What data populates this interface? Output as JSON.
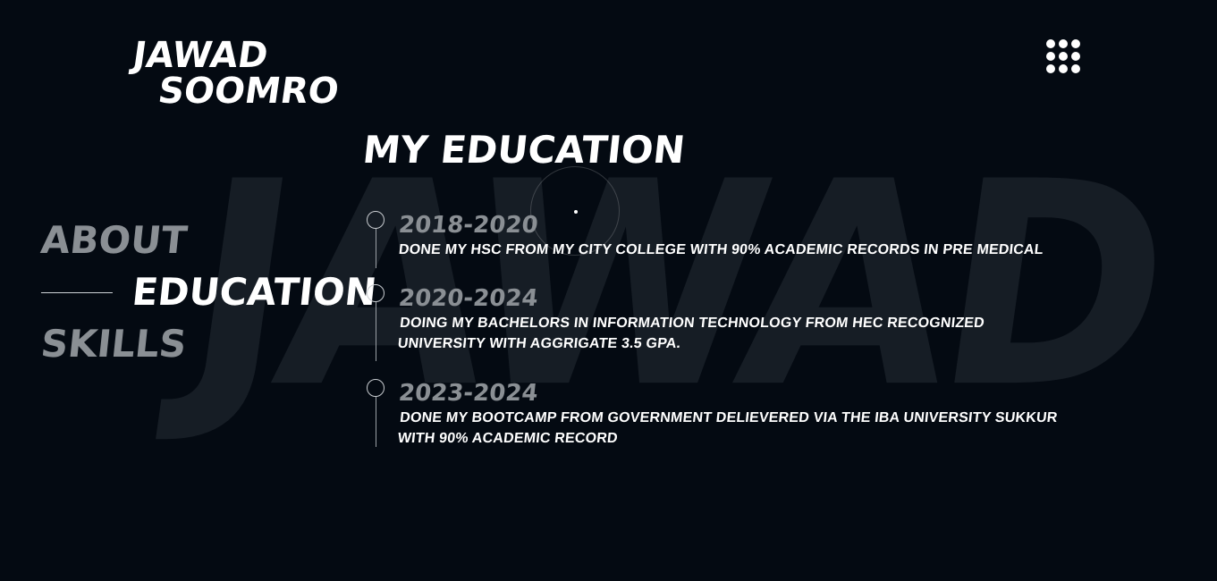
{
  "brand": {
    "line1": "JAWAD",
    "line2": "SOOMRO"
  },
  "watermark": "JAWAD",
  "menu": {
    "icon": "grid-dots-icon"
  },
  "nav": {
    "items": [
      {
        "label": "ABOUT",
        "active": false
      },
      {
        "label": "EDUCATION",
        "active": true
      },
      {
        "label": "SKILLS",
        "active": false
      }
    ]
  },
  "section": {
    "title": "MY EDUCATION"
  },
  "education": [
    {
      "year": "2018-2020",
      "description": "DONE MY HSC FROM MY CITY COLLEGE WITH 90% ACADEMIC RECORDS IN PRE MEDICAL"
    },
    {
      "year": "2020-2024",
      "description": "DOING MY BACHELORS IN INFORMATION TECHNOLOGY FROM HEC RECOGNIZED UNIVERSITY WITH AGGRIGATE 3.5 GPA."
    },
    {
      "year": "2023-2024",
      "description": "DONE MY BOOTCAMP FROM GOVERNMENT DELIEVERED VIA THE IBA UNIVERSITY SUKKUR WITH 90% ACADEMIC RECORD"
    }
  ],
  "colors": {
    "background": "#040a12",
    "text": "#ffffff",
    "muted": "#8a8f94",
    "watermark": "#1a2129"
  }
}
